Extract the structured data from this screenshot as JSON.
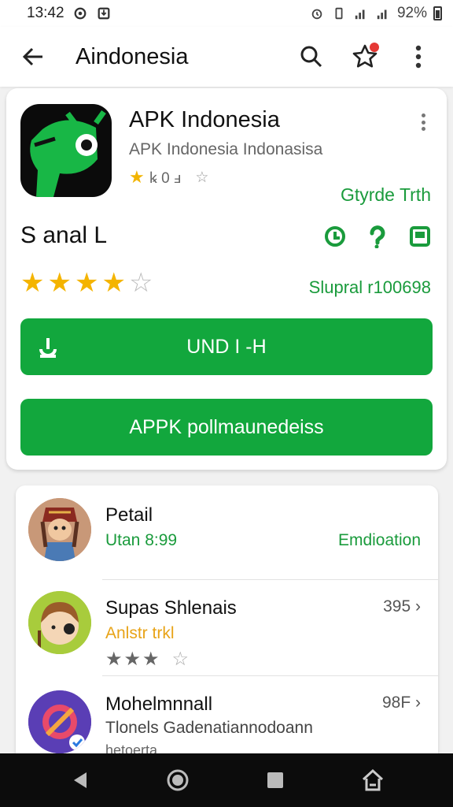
{
  "status_bar": {
    "time": "13:42",
    "battery": "92%"
  },
  "app_bar": {
    "title": "Aindonesia"
  },
  "app": {
    "name": "APK Indonesia",
    "subtitle": "APK Indonesia  Indonasisa",
    "mini_rating_text": "ꝃ 0 ⅎ",
    "developer_link": "Gtyrde Trth",
    "size_label": "S anal L",
    "rating_stars": 4,
    "rating_max": 5,
    "downloads": "Slupral r100698",
    "install_button": "UND I -H",
    "apk_button": "APPK pollmaunedeiss"
  },
  "list": [
    {
      "title": "Petail",
      "subtitle": "Utan 8:99",
      "right": "Emdioation",
      "subtitle_color": "#1a9b3c"
    },
    {
      "title": "Supas Shlenais",
      "subtitle": "Anlstr trkl",
      "right": "395 ›",
      "stars": "★★★",
      "subtitle_color": "#e8a317"
    },
    {
      "title": "Mohelmnnall",
      "subtitle": "Tlonels Gadenatiannodoann",
      "extra": "hetoerta",
      "right": "98F ›",
      "subtitle_color": "#444"
    }
  ],
  "colors": {
    "brand_green": "#12a73d",
    "star_gold": "#f4b400",
    "link_green": "#1a9b3c"
  },
  "icons": {
    "back": "arrow-left-icon",
    "search": "search-icon",
    "favorite": "star-badge-icon",
    "more": "more-vert-icon",
    "nav_back": "triangle-back-icon",
    "nav_home": "circle-home-icon",
    "nav_recent": "square-recent-icon",
    "nav_extra": "home-outline-icon"
  }
}
